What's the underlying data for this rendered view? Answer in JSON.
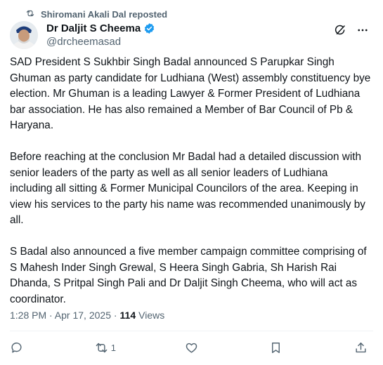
{
  "repost": {
    "label": "Shiromani Akali Dal reposted",
    "icon": "repost-icon"
  },
  "author": {
    "display_name": "Dr Daljit S Cheema",
    "handle": "@drcheemasad",
    "verified": true,
    "verified_color": "#1d9bf0"
  },
  "post": {
    "paragraphs": [
      "SAD President S Sukhbir Singh Badal announced S Parupkar  Singh Ghuman as party candidate for Ludhiana (West)  assembly constituency bye election. Mr Ghuman is a leading Lawyer & Former President of Ludhiana bar association. He has also remained a Member of Bar Council of Pb & Haryana.",
      "Before reaching at the conclusion Mr Badal had a detailed discussion with senior leaders of the party as well as all senior leaders of Ludhiana including all sitting & Former Municipal Councilors of the area. Keeping in view his services to the party his name was recommended unanimously by all.",
      "S Badal also announced a five member campaign committee comprising of S Mahesh Inder Singh Grewal, S Heera Singh Gabria, Sh Harish Rai Dhanda, S Pritpal Singh Pali and Dr Daljit Singh Cheema, who will act as coordinator."
    ],
    "timestamp": "1:28 PM · Apr 17, 2025 · ",
    "views_count": "114",
    "views_label": "Views"
  },
  "actions": {
    "reply_count": "",
    "repost_count": "1",
    "like_count": "",
    "bookmark_count": ""
  },
  "colors": {
    "text": "#0f1419",
    "muted": "#536471",
    "divider": "#eff3f4"
  }
}
